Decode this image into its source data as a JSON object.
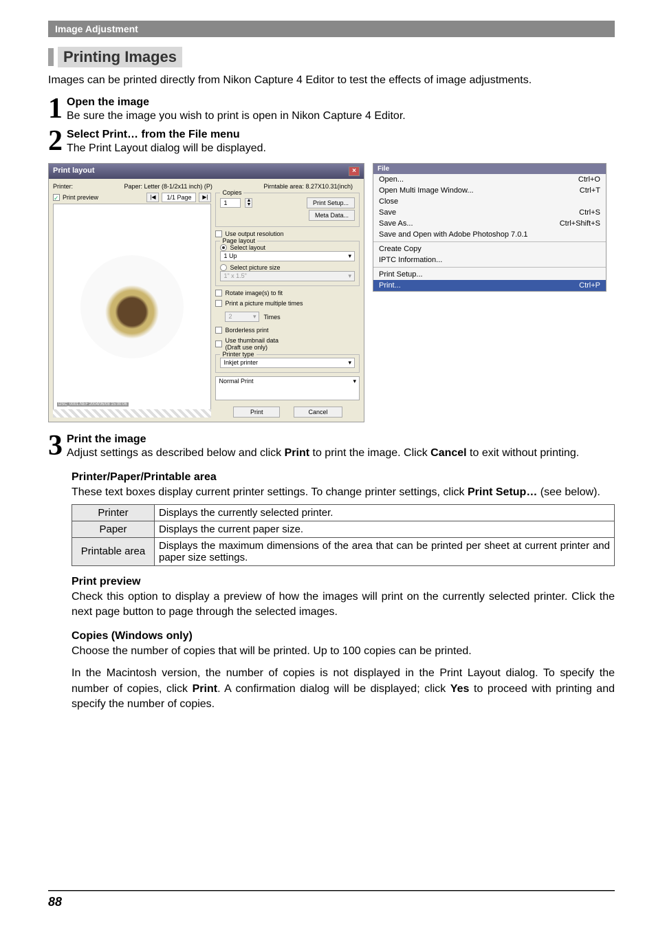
{
  "header": "Image Adjustment",
  "section_title": "Printing Images",
  "intro": "Images can be printed directly from Nikon Capture 4 Editor to test the effects of image adjustments.",
  "steps": [
    {
      "num": "1",
      "title": "Open the image",
      "text": "Be sure the image you wish to print is open in Nikon Capture 4 Editor."
    },
    {
      "num": "2",
      "title_before": "Select ",
      "title_bold": "Print…",
      "title_mid": " from the ",
      "title_bold2": "File",
      "title_after": " menu",
      "text": "The Print Layout dialog will be displayed."
    },
    {
      "num": "3",
      "title": "Print the image",
      "text_before": "Adjust settings as described below and click ",
      "text_bold1": "Print",
      "text_mid": " to print the image. Click ",
      "text_bold2": "Cancel",
      "text_after": " to exit without printing."
    }
  ],
  "dialog": {
    "title": "Print layout",
    "printer_label": "Printer:",
    "paper_label": "Paper: Letter (8-1/2x11 inch) (P)",
    "area_label": "Pirntable area: 8.27X10.31(inch)",
    "print_preview": "Print preview",
    "page_info": "1/1 Page",
    "copies_group": "Copies",
    "copies_value": "1",
    "print_setup_btn": "Print Setup...",
    "meta_btn": "Meta Data...",
    "use_output": "Use output resolution",
    "page_layout_group": "Page layout",
    "select_layout": "Select layout",
    "layout_val": "1 Up",
    "select_size": "Select picture size",
    "size_val": "1\" x 1.5\"",
    "rotate": "Rotate image(s) to fit",
    "mult": "Print a picture multiple times",
    "mult_val": "2",
    "mult_times": "Times",
    "borderless": "Borderless print",
    "thumb": "Use thumbnail data",
    "thumb2": "(Draft use only)",
    "printer_type_group": "Printer type",
    "printer_type_val": "Inkjet printer",
    "mode_val": "Normal Print",
    "print_btn": "Print",
    "cancel_btn": "Cancel"
  },
  "file_menu": {
    "title": "File",
    "items": [
      {
        "label": "Open...",
        "sc": "Ctrl+O"
      },
      {
        "label": "Open Multi Image Window...",
        "sc": "Ctrl+T"
      },
      {
        "label": "Close",
        "sc": ""
      },
      {
        "label": "Save",
        "sc": "Ctrl+S"
      },
      {
        "label": "Save As...",
        "sc": "Ctrl+Shift+S"
      },
      {
        "label": "Save and Open with Adobe Photoshop 7.0.1",
        "sc": ""
      }
    ],
    "items2": [
      {
        "label": "Create Copy",
        "sc": ""
      },
      {
        "label": "IPTC Information...",
        "sc": ""
      }
    ],
    "items3": [
      {
        "label": "Print Setup...",
        "sc": ""
      }
    ],
    "highlight": {
      "label": "Print...",
      "sc": "Ctrl+P"
    }
  },
  "sub1": {
    "title": "Printer/Paper/Printable area",
    "text_before": "These text boxes display current printer settings. To change printer settings, click ",
    "text_bold1": "Print Setup…",
    "text_after": " (see below)."
  },
  "table": {
    "rows": [
      {
        "label": "Printer",
        "desc": "Displays the currently selected printer."
      },
      {
        "label": "Paper",
        "desc": "Displays the current paper size."
      },
      {
        "label": "Printable area",
        "desc": "Displays the maximum dimensions of the area that can be printed per sheet at current printer and paper size settings."
      }
    ]
  },
  "sub2": {
    "title": "Print preview",
    "text": "Check this option to display a preview of how the images will print on the currently selected printer. Click the next page button to page through the selected images."
  },
  "sub3": {
    "title": "Copies (Windows only)",
    "text": "Choose the number of copies that will be printed. Up to 100 copies can be printed.",
    "text2_before": "In the Macintosh version, the number of copies is not displayed in the Print Layout dialog. To specify the number of copies, click ",
    "text2_bold1": "Print",
    "text2_mid": ". A confirmation dialog will be displayed; click ",
    "text2_bold2": "Yes",
    "text2_after": " to proceed with printing and specify the number of copies."
  },
  "page_number": "88"
}
